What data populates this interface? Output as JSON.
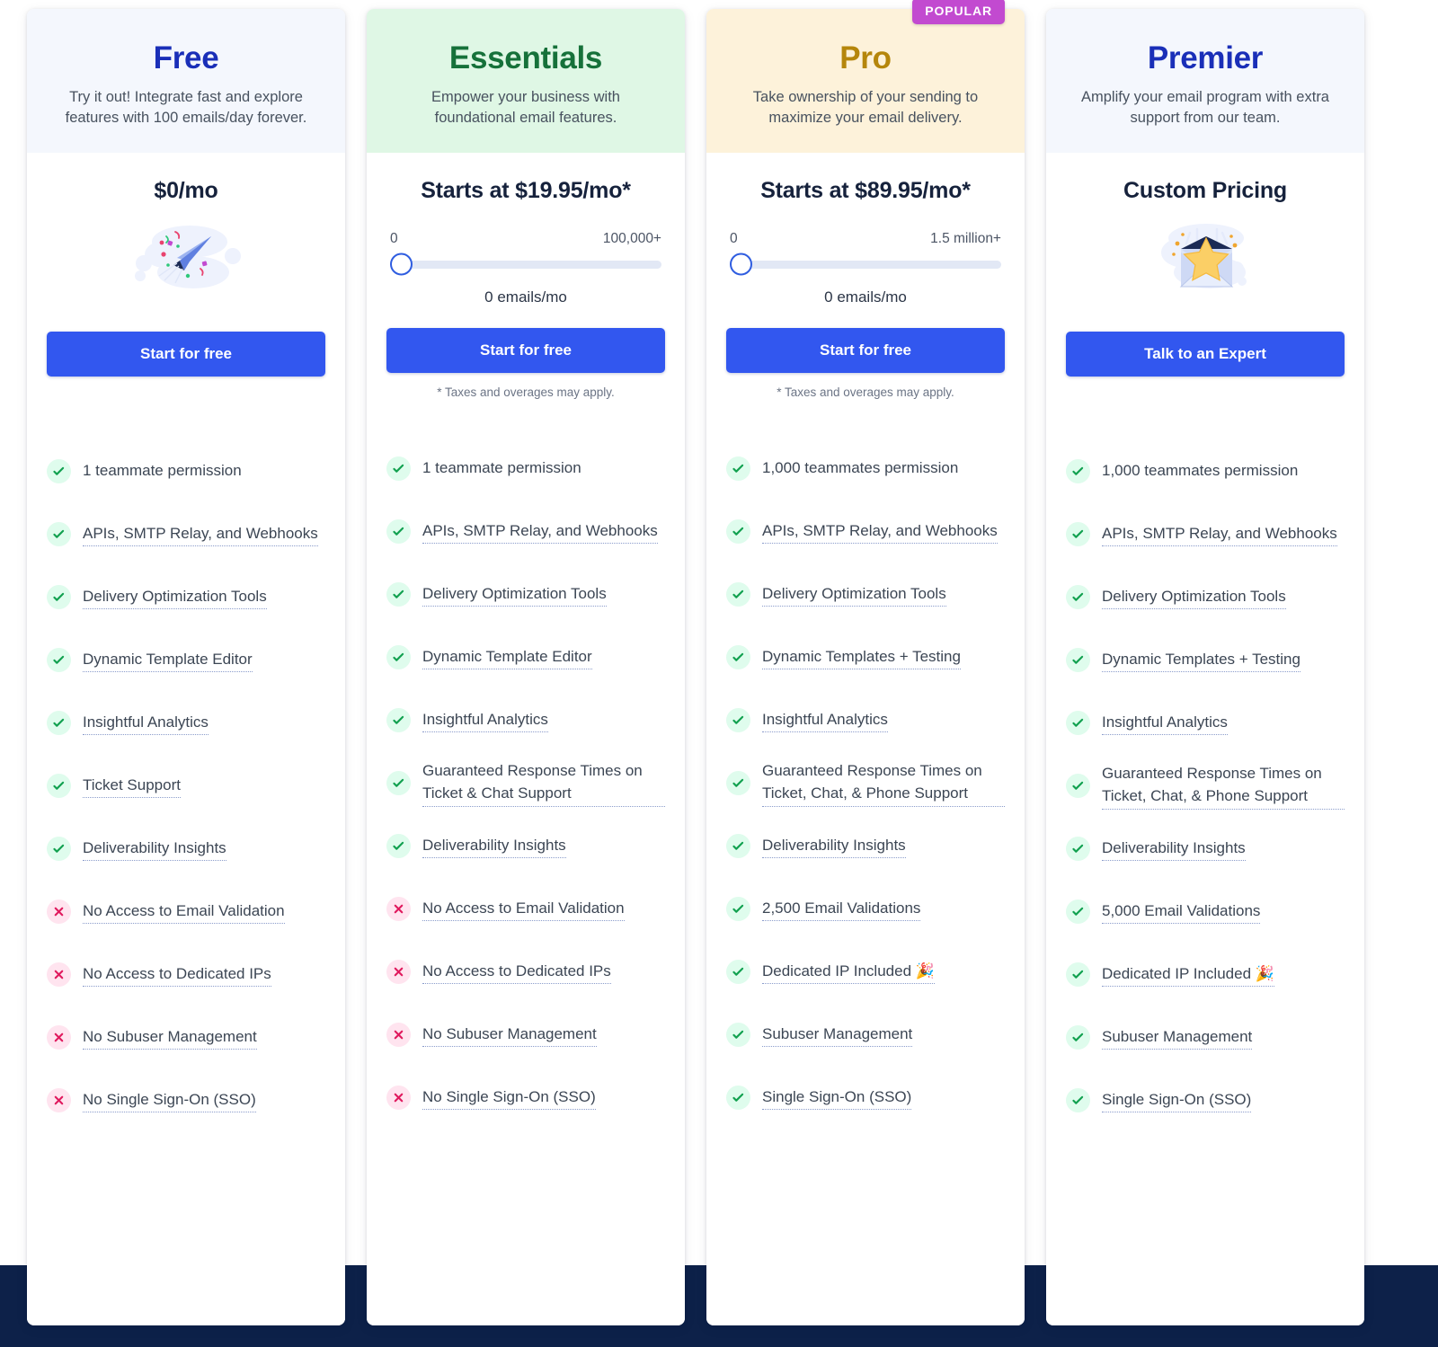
{
  "colors": {
    "primary_button": "#3257ef",
    "popular_badge": "#c24ad0",
    "free_name": "#1a2fb8",
    "essentials_name": "#16713a",
    "pro_name": "#b5860b",
    "premier_name": "#1a2fb8",
    "bottom_band": "#0d2149",
    "check_bg": "#dffced",
    "cross_bg": "#ffe4ef"
  },
  "popular_badge_label": "POPULAR",
  "tax_note": "* Taxes and overages may apply.",
  "plans": [
    {
      "name": "Free",
      "description": "Try it out! Integrate fast and explore features with 100 emails/day forever.",
      "price": "$0/mo",
      "illustration": "paper-plane-illustration",
      "cta_label": "Start for free",
      "has_slider": false,
      "has_tax_note": false,
      "features": [
        {
          "label": "1 teammate permission",
          "included": true,
          "link": false
        },
        {
          "label": "APIs, SMTP Relay, and Webhooks",
          "included": true,
          "link": true
        },
        {
          "label": "Delivery Optimization Tools",
          "included": true,
          "link": true
        },
        {
          "label": "Dynamic Template Editor",
          "included": true,
          "link": true
        },
        {
          "label": "Insightful Analytics",
          "included": true,
          "link": true
        },
        {
          "label": "Ticket Support",
          "included": true,
          "link": true
        },
        {
          "label": "Deliverability Insights",
          "included": true,
          "link": true
        },
        {
          "label": "No Access to Email Validation",
          "included": false,
          "link": true
        },
        {
          "label": "No Access to Dedicated IPs",
          "included": false,
          "link": true
        },
        {
          "label": "No Subuser Management",
          "included": false,
          "link": true
        },
        {
          "label": "No Single Sign-On (SSO)",
          "included": false,
          "link": true
        }
      ]
    },
    {
      "name": "Essentials",
      "description": "Empower your business with foundational email features.",
      "price": "Starts at $19.95/mo*",
      "illustration": null,
      "cta_label": "Start for free",
      "has_slider": true,
      "has_tax_note": true,
      "slider": {
        "min_label": "0",
        "max_label": "100,000+",
        "value_label": "0 emails/mo",
        "value_percent": 0
      },
      "features": [
        {
          "label": "1 teammate permission",
          "included": true,
          "link": false
        },
        {
          "label": "APIs, SMTP Relay, and Webhooks",
          "included": true,
          "link": true
        },
        {
          "label": "Delivery Optimization Tools",
          "included": true,
          "link": true
        },
        {
          "label": "Dynamic Template Editor",
          "included": true,
          "link": true
        },
        {
          "label": "Insightful Analytics",
          "included": true,
          "link": true
        },
        {
          "label": "Guaranteed Response Times on Ticket & Chat Support",
          "included": true,
          "link": true
        },
        {
          "label": "Deliverability Insights",
          "included": true,
          "link": true
        },
        {
          "label": "No Access to Email Validation",
          "included": false,
          "link": true
        },
        {
          "label": "No Access to Dedicated IPs",
          "included": false,
          "link": true
        },
        {
          "label": "No Subuser Management",
          "included": false,
          "link": true
        },
        {
          "label": "No Single Sign-On (SSO)",
          "included": false,
          "link": true
        }
      ]
    },
    {
      "name": "Pro",
      "description": "Take ownership of your sending to maximize your email delivery.",
      "price": "Starts at $89.95/mo*",
      "illustration": null,
      "cta_label": "Start for free",
      "has_slider": true,
      "has_tax_note": true,
      "popular": true,
      "slider": {
        "min_label": "0",
        "max_label": "1.5 million+",
        "value_label": "0 emails/mo",
        "value_percent": 0
      },
      "features": [
        {
          "label": "1,000 teammates permission",
          "included": true,
          "link": false
        },
        {
          "label": "APIs, SMTP Relay, and Webhooks",
          "included": true,
          "link": true
        },
        {
          "label": "Delivery Optimization Tools",
          "included": true,
          "link": true
        },
        {
          "label": "Dynamic Templates + Testing",
          "included": true,
          "link": true
        },
        {
          "label": "Insightful Analytics",
          "included": true,
          "link": true
        },
        {
          "label": "Guaranteed Response Times on Ticket, Chat, & Phone Support",
          "included": true,
          "link": true
        },
        {
          "label": "Deliverability Insights",
          "included": true,
          "link": true
        },
        {
          "label": "2,500 Email Validations",
          "included": true,
          "link": true
        },
        {
          "label": "Dedicated IP Included 🎉",
          "included": true,
          "link": true
        },
        {
          "label": "Subuser Management",
          "included": true,
          "link": true
        },
        {
          "label": "Single Sign-On (SSO)",
          "included": true,
          "link": true
        }
      ]
    },
    {
      "name": "Premier",
      "description": "Amplify your email program with extra support from our team.",
      "price": "Custom Pricing",
      "illustration": "envelope-star-illustration",
      "cta_label": "Talk to an Expert",
      "has_slider": false,
      "has_tax_note": false,
      "features": [
        {
          "label": "1,000 teammates permission",
          "included": true,
          "link": false
        },
        {
          "label": "APIs, SMTP Relay, and Webhooks",
          "included": true,
          "link": true
        },
        {
          "label": "Delivery Optimization Tools",
          "included": true,
          "link": true
        },
        {
          "label": "Dynamic Templates + Testing",
          "included": true,
          "link": true
        },
        {
          "label": "Insightful Analytics",
          "included": true,
          "link": true
        },
        {
          "label": "Guaranteed Response Times on Ticket, Chat, & Phone Support",
          "included": true,
          "link": true
        },
        {
          "label": "Deliverability Insights",
          "included": true,
          "link": true
        },
        {
          "label": "5,000 Email Validations",
          "included": true,
          "link": true
        },
        {
          "label": "Dedicated IP Included 🎉",
          "included": true,
          "link": true
        },
        {
          "label": "Subuser Management",
          "included": true,
          "link": true
        },
        {
          "label": "Single Sign-On (SSO)",
          "included": true,
          "link": true
        }
      ]
    }
  ]
}
